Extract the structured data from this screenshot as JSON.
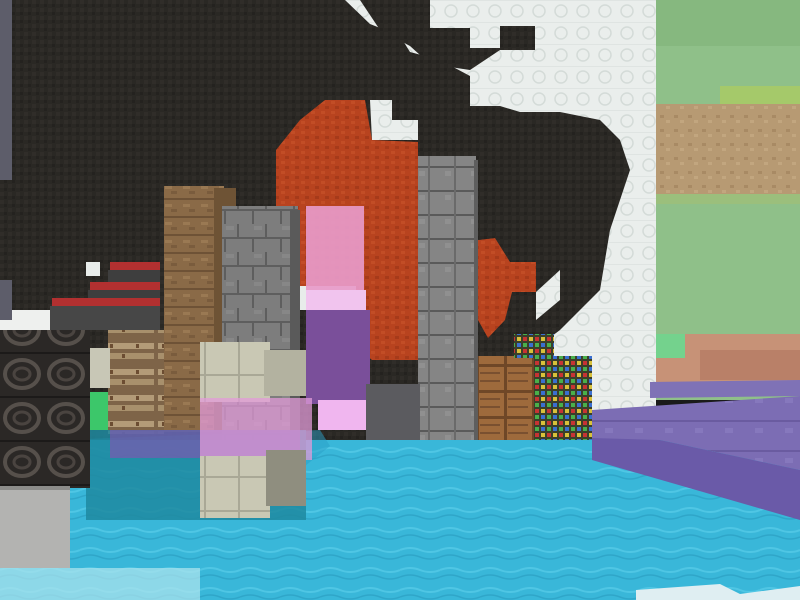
{
  "scene": {
    "type": "voxel-game-first-person",
    "hud_visible": false,
    "blocks": [
      "black-wool-mosaic",
      "white-wool-mosaic",
      "red-wool-mosaic",
      "pink-stained-glass",
      "purple-concrete",
      "oak-planks",
      "stone-bricks",
      "stone-pillar",
      "bookshelf",
      "jukebox",
      "red-carpet",
      "birch-block",
      "purple-block",
      "redstone-lamp",
      "glass",
      "water"
    ]
  },
  "colors": {
    "sky_green": "#8fc089",
    "dark_wool": "#2a2824",
    "white_wool": "#eaeeec",
    "red_wool": "#b8431f",
    "water": "#39b7d9",
    "stone": "#7d7d7d",
    "oak": "#8a6a47",
    "purple": "#7c6db4",
    "pink_glass": "#e79ac9",
    "jukebox": "#3a3330"
  }
}
